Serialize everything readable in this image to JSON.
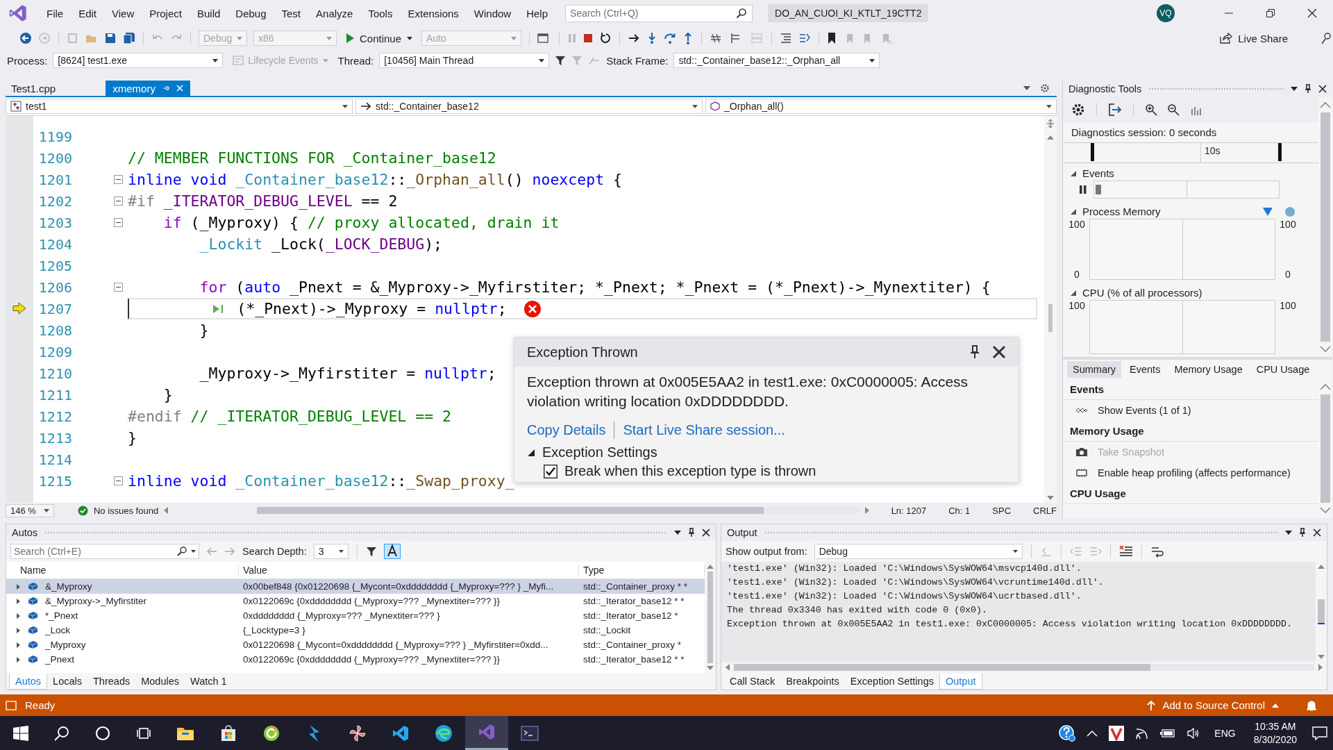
{
  "menu_bar": {
    "items": [
      "File",
      "Edit",
      "View",
      "Project",
      "Build",
      "Debug",
      "Test",
      "Analyze",
      "Tools",
      "Extensions",
      "Window",
      "Help"
    ],
    "search": {
      "placeholder": "Search (Ctrl+Q)"
    },
    "solution": "DO_AN_CUOI_KI_KTLT_19CTT2",
    "avatar": "VQ"
  },
  "toolbar": {
    "configuration": {
      "value": "Debug",
      "disabled": true
    },
    "platform": {
      "value": "x86",
      "disabled": true
    },
    "continue": "Continue",
    "target": {
      "value": "Auto",
      "disabled": true
    },
    "live_share": "Live Share"
  },
  "debug_location": {
    "process_label": "Process:",
    "process": "[8624] test1.exe",
    "lifecycle": {
      "label": "Lifecycle Events",
      "disabled": true
    },
    "thread_label": "Thread:",
    "thread": "[10456] Main Thread",
    "stack_label": "Stack Frame:",
    "stack_frame": "std::_Container_base12::_Orphan_all"
  },
  "doc_tabs": [
    {
      "label": "Test1.cpp",
      "selected": false
    },
    {
      "label": "xmemory",
      "selected": true
    }
  ],
  "nav_bar": {
    "project": "test1",
    "scope": "std::_Container_base12",
    "member": "_Orphan_all()"
  },
  "editor": {
    "lines": [
      {
        "number": "1199",
        "collapsible": false,
        "current": false,
        "error": false
      },
      {
        "number": "1200",
        "collapsible": false,
        "current": false,
        "error": false,
        "tokens": [
          {
            "kind": "comment",
            "text": "// MEMBER FUNCTIONS FOR _Container_base12"
          }
        ]
      },
      {
        "number": "1201",
        "collapsible": true,
        "current": false,
        "error": false,
        "tokens": [
          {
            "kind": "keyword",
            "text": "inline "
          },
          {
            "kind": "keyword",
            "text": "void "
          },
          {
            "kind": "type",
            "text": "_Container_base12"
          },
          {
            "kind": "plain",
            "text": "::"
          },
          {
            "kind": "function",
            "text": "_Orphan_all"
          },
          {
            "kind": "plain",
            "text": "() "
          },
          {
            "kind": "keyword",
            "text": "noexcept"
          },
          {
            "kind": "plain",
            "text": " {"
          }
        ]
      },
      {
        "number": "1202",
        "collapsible": true,
        "current": false,
        "error": false,
        "tokens": [
          {
            "kind": "preprocessor",
            "text": "#if "
          },
          {
            "kind": "macro",
            "text": "_ITERATOR_DEBUG_LEVEL"
          },
          {
            "kind": "plain",
            "text": " == 2"
          }
        ]
      },
      {
        "number": "1203",
        "collapsible": true,
        "current": false,
        "error": false,
        "tokens": [
          {
            "kind": "control",
            "text": "    if"
          },
          {
            "kind": "plain",
            "text": " (_Myproxy) { "
          },
          {
            "kind": "comment",
            "text": "// proxy allocated, drain it"
          }
        ]
      },
      {
        "number": "1204",
        "collapsible": false,
        "current": false,
        "error": false,
        "tokens": [
          {
            "kind": "type",
            "text": "        _Lockit"
          },
          {
            "kind": "plain",
            "text": " _Lock("
          },
          {
            "kind": "macro",
            "text": "_LOCK_DEBUG"
          },
          {
            "kind": "plain",
            "text": ");"
          }
        ]
      },
      {
        "number": "1205",
        "collapsible": false,
        "current": false,
        "error": false
      },
      {
        "number": "1206",
        "collapsible": true,
        "current": false,
        "error": false,
        "tokens": [
          {
            "kind": "control",
            "text": "        for"
          },
          {
            "kind": "plain",
            "text": " ("
          },
          {
            "kind": "keyword",
            "text": "auto"
          },
          {
            "kind": "plain",
            "text": " _Pnext = &_Myproxy->_Myfirstiter; *_Pnext; *_Pnext = (*_Pnext)->_Mynextiter) {"
          }
        ]
      },
      {
        "number": "1207",
        "collapsible": false,
        "current": true,
        "error": true,
        "tokens": [
          {
            "kind": "plain",
            "text": "            (*_Pnext)->_Myproxy = "
          },
          {
            "kind": "keyword",
            "text": "nullptr"
          },
          {
            "kind": "plain",
            "text": ";"
          }
        ]
      },
      {
        "number": "1208",
        "collapsible": false,
        "current": false,
        "error": false,
        "tokens": [
          {
            "kind": "plain",
            "text": "        }"
          }
        ]
      },
      {
        "number": "1209",
        "collapsible": false,
        "current": false,
        "error": false
      },
      {
        "number": "1210",
        "collapsible": false,
        "current": false,
        "error": false,
        "tokens": [
          {
            "kind": "plain",
            "text": "        _Myproxy->_Myfirstiter = "
          },
          {
            "kind": "keyword",
            "text": "nullptr"
          },
          {
            "kind": "plain",
            "text": ";"
          }
        ]
      },
      {
        "number": "1211",
        "collapsible": false,
        "current": false,
        "error": false,
        "tokens": [
          {
            "kind": "plain",
            "text": "    }"
          }
        ]
      },
      {
        "number": "1212",
        "collapsible": false,
        "current": false,
        "error": false,
        "tokens": [
          {
            "kind": "preprocessor",
            "text": "#endif "
          },
          {
            "kind": "comment",
            "text": "// _ITERATOR_DEBUG_LEVEL == 2"
          }
        ]
      },
      {
        "number": "1213",
        "collapsible": false,
        "current": false,
        "error": false,
        "tokens": [
          {
            "kind": "plain",
            "text": "}"
          }
        ]
      },
      {
        "number": "1214",
        "collapsible": false,
        "current": false,
        "error": false
      },
      {
        "number": "1215",
        "collapsible": true,
        "current": false,
        "error": false,
        "tokens": [
          {
            "kind": "keyword",
            "text": "inline "
          },
          {
            "kind": "keyword",
            "text": "void "
          },
          {
            "kind": "type",
            "text": "_Container_base12"
          },
          {
            "kind": "plain",
            "text": "::"
          },
          {
            "kind": "function",
            "text": "_Swap_proxy_"
          }
        ]
      }
    ],
    "zoom": "146 %",
    "issues": "No issues found",
    "ln": "Ln: 1207",
    "ch": "Ch: 1",
    "spc": "SPC",
    "crlf": "CRLF"
  },
  "exception": {
    "title": "Exception Thrown",
    "message": "Exception thrown at 0x005E5AA2 in test1.exe: 0xC0000005: Access violation writing location 0xDDDDDDDD.",
    "links": [
      "Copy Details",
      "Start Live Share session..."
    ],
    "settings": {
      "label": "Exception Settings",
      "expanded": true,
      "options": [
        {
          "label": "Break when this exception type is thrown",
          "checked": true
        }
      ]
    }
  },
  "diagnostic_tools": {
    "title": "Diagnostic Tools",
    "session": "Diagnostics session: 0 seconds",
    "ruler": "10s",
    "graphs": [
      {
        "kind": "events",
        "label": "Events",
        "expanded": true
      },
      {
        "kind": "memory",
        "label": "Process Memory",
        "expanded": true,
        "left_axis": [
          "100",
          "0"
        ],
        "right_axis": [
          "100",
          "0"
        ]
      },
      {
        "kind": "cpu",
        "label": "CPU (% of all processors)",
        "expanded": true,
        "left_axis": [
          "100"
        ],
        "right_axis": [
          "100"
        ]
      }
    ],
    "tabs": [
      {
        "label": "Summary",
        "selected": true
      },
      {
        "label": "Events",
        "selected": false
      },
      {
        "label": "Memory Usage",
        "selected": false
      },
      {
        "label": "CPU Usage",
        "selected": false
      }
    ],
    "summary": [
      {
        "heading": "Events",
        "items": [
          {
            "kind": "events",
            "label": "Show Events (1 of 1)",
            "disabled": false
          }
        ]
      },
      {
        "heading": "Memory Usage",
        "items": [
          {
            "kind": "snapshot",
            "label": "Take Snapshot",
            "disabled": true
          },
          {
            "kind": "heap",
            "label": "Enable heap profiling (affects performance)",
            "disabled": false
          }
        ]
      },
      {
        "heading": "CPU Usage"
      }
    ]
  },
  "autos": {
    "title": "Autos",
    "search": {
      "placeholder": "Search (Ctrl+E)"
    },
    "depth_label": "Search Depth:",
    "depth": "3",
    "columns": [
      "Name",
      "Value",
      "Type"
    ],
    "rows": [
      {
        "name": "&_Myproxy",
        "value": "0x00bef848 {0x01220698 {_Mycont=0xdddddddd {_Myproxy=??? } _Myfi...",
        "type": "std::_Container_proxy * *",
        "selected": true
      },
      {
        "name": "&_Myproxy->_Myfirstiter",
        "value": "0x0122069c {0xdddddddd {_Myproxy=??? _Mynextiter=??? }}",
        "type": "std::_Iterator_base12 * *",
        "selected": false
      },
      {
        "name": "*_Pnext",
        "value": "0xdddddddd {_Myproxy=??? _Mynextiter=??? }",
        "type": "std::_Iterator_base12 *",
        "selected": false
      },
      {
        "name": "_Lock",
        "value": "{_Locktype=3 }",
        "type": "std::_Lockit",
        "selected": false
      },
      {
        "name": "_Myproxy",
        "value": "0x01220698 {_Mycont=0xdddddddd {_Myproxy=??? } _Myfirstiter=0xdd...",
        "type": "std::_Container_proxy *",
        "selected": false
      },
      {
        "name": "_Pnext",
        "value": "0x0122069c {0xdddddddd {_Myproxy=??? _Mynextiter=??? }}",
        "type": "std::_Iterator_base12 * *",
        "selected": false
      }
    ]
  },
  "left_tabs": [
    {
      "label": "Autos",
      "selected": true
    },
    {
      "label": "Locals",
      "selected": false
    },
    {
      "label": "Threads",
      "selected": false
    },
    {
      "label": "Modules",
      "selected": false
    },
    {
      "label": "Watch 1",
      "selected": false
    }
  ],
  "output": {
    "title": "Output",
    "source_label": "Show output from:",
    "source": "Debug",
    "lines": [
      "'test1.exe' (Win32): Loaded 'C:\\Windows\\SysWOW64\\msvcp140d.dll'.",
      "'test1.exe' (Win32): Loaded 'C:\\Windows\\SysWOW64\\vcruntime140d.dll'.",
      "'test1.exe' (Win32): Loaded 'C:\\Windows\\SysWOW64\\ucrtbased.dll'.",
      "The thread 0x3340 has exited with code 0 (0x0).",
      "Exception thrown at 0x005E5AA2 in test1.exe: 0xC0000005: Access violation writing location 0xDDDDDDDD."
    ]
  },
  "right_tabs": [
    {
      "label": "Call Stack",
      "selected": false
    },
    {
      "label": "Breakpoints",
      "selected": false
    },
    {
      "label": "Exception Settings",
      "selected": false
    },
    {
      "label": "Output",
      "selected": true
    }
  ],
  "status_bar": {
    "text": "Ready",
    "source_control": "Add to Source Control"
  },
  "taskbar": {
    "apps": [
      {
        "kind": "explorer",
        "selected": false
      },
      {
        "kind": "store",
        "selected": false
      },
      {
        "kind": "green",
        "selected": false
      },
      {
        "kind": "bolt",
        "selected": false
      },
      {
        "kind": "pinwheel",
        "selected": false
      },
      {
        "kind": "vscode",
        "selected": false
      },
      {
        "kind": "edge",
        "selected": false
      },
      {
        "kind": "vs",
        "selected": true
      },
      {
        "kind": "terminal",
        "selected": false
      }
    ],
    "language": "ENG",
    "time": "10:35 AM",
    "date": "8/30/2020"
  }
}
